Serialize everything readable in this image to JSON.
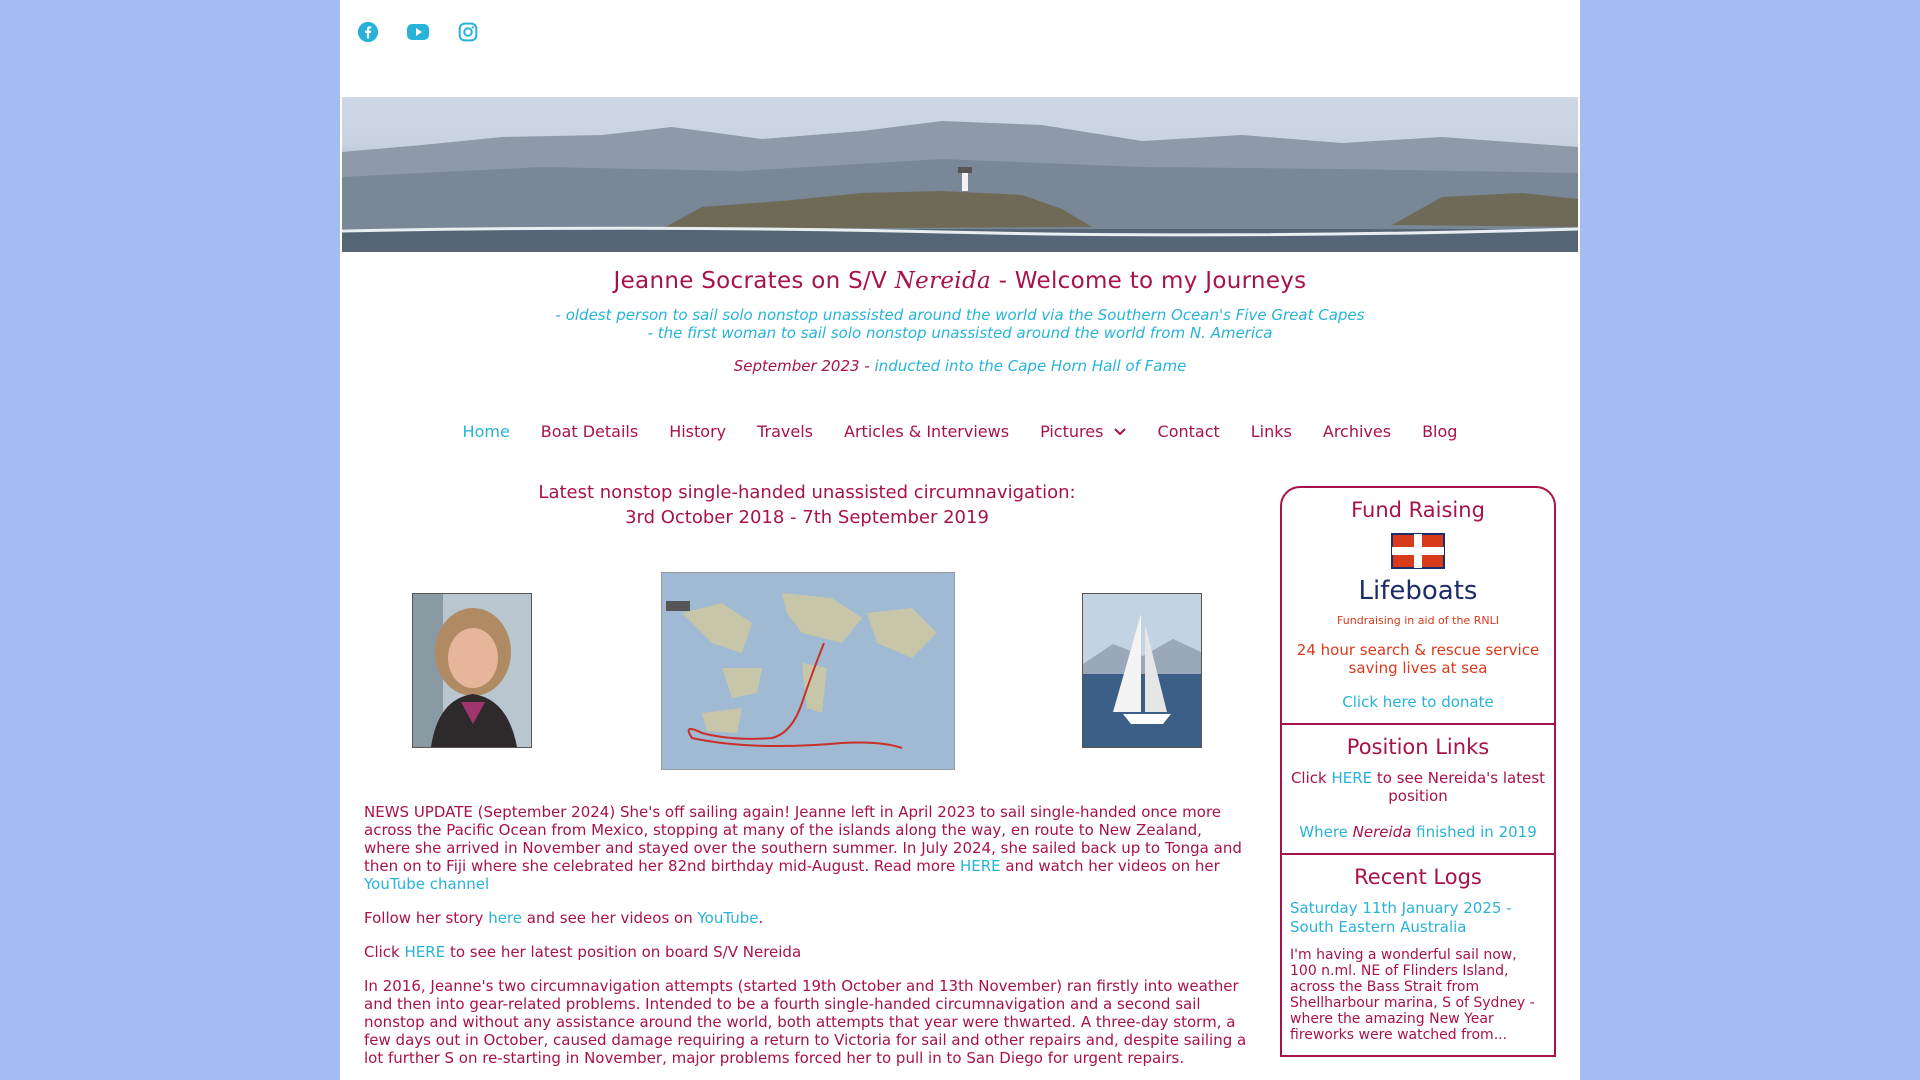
{
  "social": [
    {
      "name": "facebook-icon"
    },
    {
      "name": "youtube-icon"
    },
    {
      "name": "instagram-icon"
    }
  ],
  "colors": {
    "brand": "#a8124b",
    "link": "#27b3d9",
    "background": "#a3bdf3",
    "accent_red": "#d83a1c"
  },
  "header": {
    "title_prefix": "Jeanne Socrates on S/V ",
    "title_boat": "Nereida",
    "title_suffix": " - Welcome to my Journeys",
    "tagline_1": "- oldest person to sail solo nonstop unassisted around the world via the Southern Ocean's Five Great Capes",
    "tagline_2": "- the first woman to sail solo nonstop unassisted around the world from N. America",
    "hof_date": "September 2023 - ",
    "hof_link": "inducted into the Cape Horn Hall of Fame"
  },
  "nav": {
    "items": [
      "Home",
      "Boat Details",
      "History",
      "Travels",
      "Articles & Interviews",
      "Pictures",
      "Contact",
      "Links",
      "Archives",
      "Blog"
    ]
  },
  "main": {
    "latest_1": "Latest nonstop single-handed unassisted circumnavigation:",
    "latest_2": "3rd October 2018 - 7th September 2019",
    "news_1": "NEWS UPDATE  (September 2024) She's off sailing again!  Jeanne left in April 2023 to sail single-handed once more across the Pacific Ocean from Mexico, stopping at many of the islands along the way, en route to New Zealand, where she arrived in November and stayed over the southern summer.   In July 2024, she sailed back up to Tonga and then on to Fiji where she celebrated her 82nd birthday mid-August. Read more ",
    "news_here": "HERE",
    "news_2": " and watch her videos on her ",
    "news_youtube": "YouTube channel",
    "follow_1": "Follow her story ",
    "follow_here": "here",
    "follow_2": " and see her videos on ",
    "follow_youtube": "YouTube",
    "follow_3": ".",
    "click_1": "Click ",
    "click_here": "HERE",
    "click_2": " to see her latest position on board S/V Nereida",
    "history": "In 2016, Jeanne's two circumnavigation attempts (started 19th October and 13th November) ran firstly into weather and then into gear-related problems. Intended to be a fourth single-handed circumnavigation and a second sail  nonstop and without any assistance around the world, both attempts that year were thwarted. A three-day storm, a few days out in October, caused damage requiring a return to Victoria for sail and other repairs and, despite sailing a lot further S on re-starting in November, major problems forced her to pull in to San Diego for urgent repairs."
  },
  "sidebar": {
    "fund_title": "Fund Raising",
    "rnli_word": "Lifeboats",
    "rnli_sub": "Fundraising in aid of the RNLI",
    "rescue": "24 hour search & rescue service saving lives at sea",
    "donate": "Click here to donate",
    "pos_title": "Position Links",
    "pos_click": "Click ",
    "pos_here": "HERE",
    "pos_rest": " to see Nereida's latest position",
    "where_1": "Where ",
    "where_boat": "Nereida",
    "where_2": " finished in 2019",
    "logs_title": "Recent Logs",
    "log_date": "Saturday 11th January 2025 - South Eastern Australia",
    "log_text": "I'm having a wonderful sail now, 100 n.ml. NE of Flinders Island, across the Bass Strait from Shellharbour marina, S of Sydney - where the amazing New Year fireworks were watched from..."
  }
}
